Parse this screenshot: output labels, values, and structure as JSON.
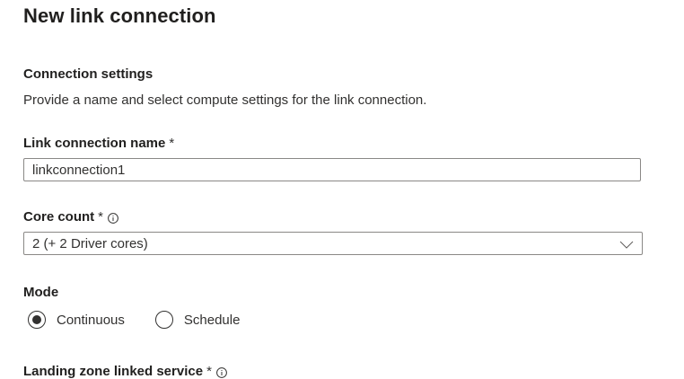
{
  "header": {
    "title": "New link connection"
  },
  "connection_settings": {
    "title": "Connection settings",
    "description": "Provide a name and select compute settings for the link connection."
  },
  "link_connection_name": {
    "label": "Link connection name",
    "required_marker": "*",
    "value": "linkconnection1"
  },
  "core_count": {
    "label": "Core count",
    "required_marker": "*",
    "selected": "2 (+ 2 Driver cores)",
    "icons": {
      "info": "info-icon",
      "dropdown": "chevron-down-icon"
    }
  },
  "mode": {
    "label": "Mode",
    "options": [
      {
        "label": "Continuous",
        "selected": true
      },
      {
        "label": "Schedule",
        "selected": false
      }
    ]
  },
  "landing_zone": {
    "label": "Landing zone linked service",
    "required_marker": "*",
    "icons": {
      "info": "info-icon"
    }
  },
  "colors": {
    "text": "#323130",
    "heading": "#201f1e",
    "border": "#8a8886"
  }
}
